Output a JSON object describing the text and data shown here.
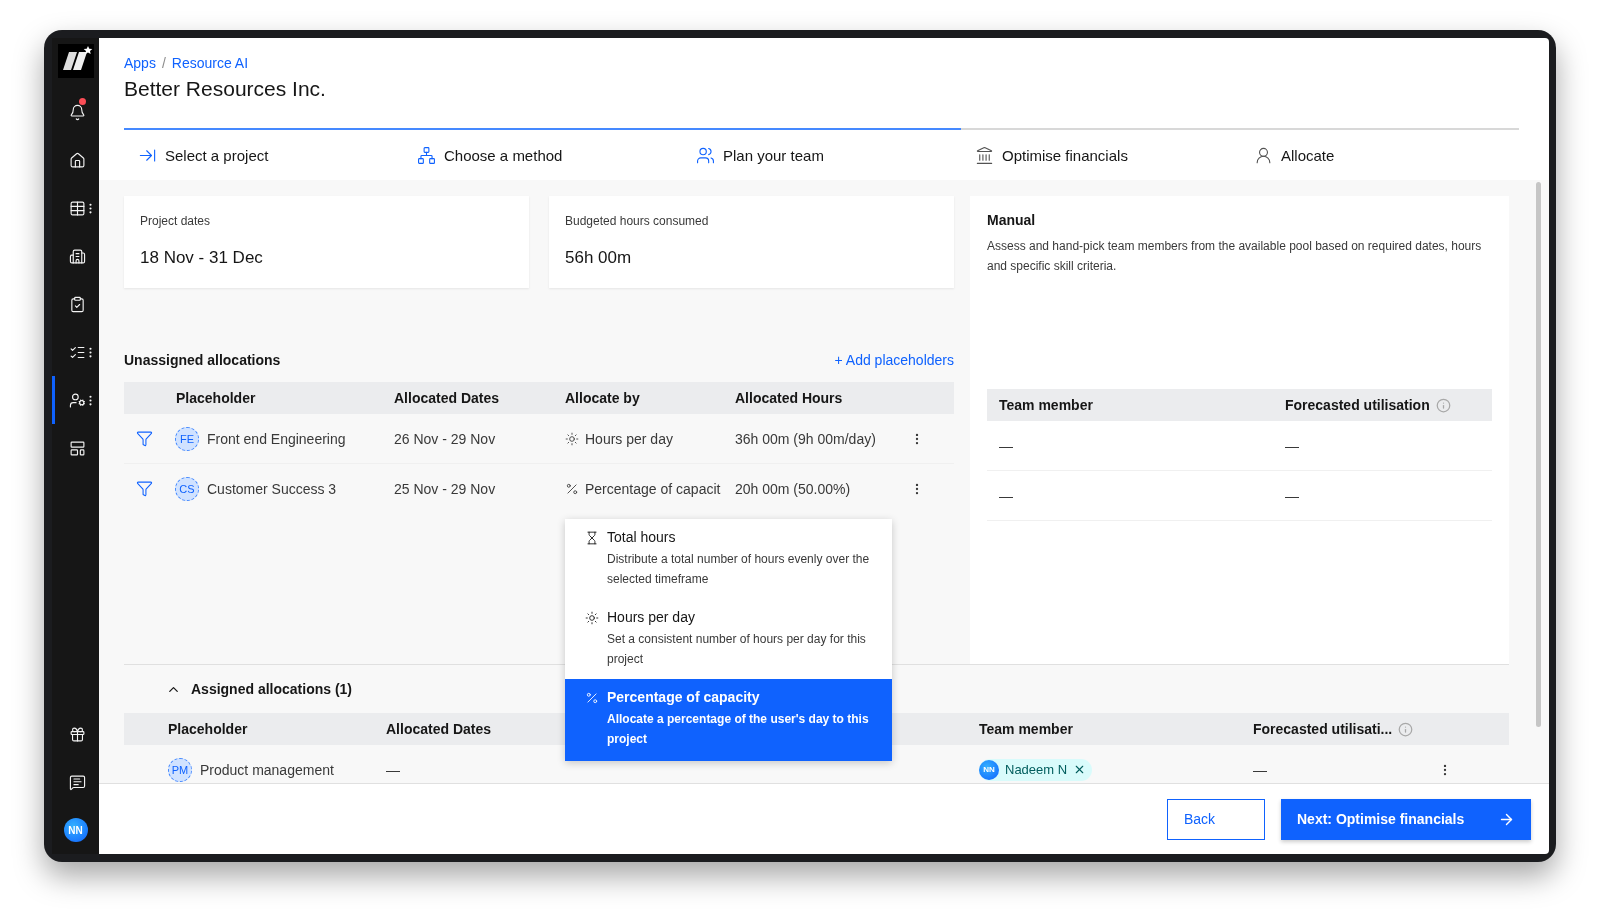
{
  "sidebar": {
    "top": [
      {
        "kind": "bell",
        "selected": false,
        "alert": true,
        "menu": false
      },
      {
        "kind": "home",
        "selected": false,
        "alert": false,
        "menu": false
      },
      {
        "kind": "table",
        "selected": false,
        "alert": false,
        "menu": true
      },
      {
        "kind": "building",
        "selected": false,
        "alert": false,
        "menu": false
      },
      {
        "kind": "clipboard",
        "selected": false,
        "alert": false,
        "menu": false
      },
      {
        "kind": "checklist",
        "selected": false,
        "alert": false,
        "menu": true
      },
      {
        "kind": "people",
        "selected": true,
        "alert": false,
        "menu": true
      },
      {
        "kind": "layout",
        "selected": false,
        "alert": false,
        "menu": false
      }
    ],
    "bottom": [
      {
        "kind": "gift"
      },
      {
        "kind": "chat"
      }
    ],
    "avatar": "NN"
  },
  "breadcrumb": {
    "items": [
      "Apps",
      "Resource AI"
    ],
    "separator": "/"
  },
  "title": "Better Resources Inc.",
  "steps": [
    {
      "kind": "project",
      "label": "Select a project",
      "reached": true
    },
    {
      "kind": "method",
      "label": "Choose a method",
      "reached": true
    },
    {
      "kind": "team",
      "label": "Plan your team",
      "reached": true
    },
    {
      "kind": "finance",
      "label": "Optimise financials",
      "reached": false
    },
    {
      "kind": "allocate",
      "label": "Allocate",
      "reached": false
    }
  ],
  "cards": [
    {
      "label": "Project dates",
      "value": "18 Nov - 31 Dec"
    },
    {
      "label": "Budgeted hours consumed",
      "value": "56h 00m"
    }
  ],
  "method": {
    "title": "Manual",
    "description": "Assess and hand-pick team members from the available pool based on required dates, hours and specific skill criteria."
  },
  "unassigned": {
    "title": "Unassigned allocations",
    "add_link": "+ Add placeholders",
    "columns": [
      "Placeholder",
      "Allocated Dates",
      "Allocate by",
      "Allocated Hours"
    ],
    "rows": [
      {
        "initials": "FE",
        "name": "Front end Engineering",
        "dates": "26 Nov - 29 Nov",
        "kind": "day",
        "allocate_by": "Hours per day",
        "hours": "36h 00m (9h 00m/day)"
      },
      {
        "initials": "CS",
        "name": "Customer Success 3",
        "dates": "25 Nov - 29 Nov",
        "kind": "percent",
        "allocate_by": "Percentage of capacit",
        "hours": "20h 00m (50.00%)"
      }
    ]
  },
  "team_table": {
    "columns": [
      "Team member",
      "Forecasted utilisation"
    ],
    "rows": [
      {
        "member": "—",
        "forecast": "—"
      },
      {
        "member": "—",
        "forecast": "—"
      }
    ]
  },
  "dropdown": {
    "options": [
      {
        "kind": "total",
        "title": "Total hours",
        "description": "Distribute a total number of hours evenly over the selected timeframe",
        "selected": false
      },
      {
        "kind": "day",
        "title": "Hours per day",
        "description": "Set a consistent number of hours per day for this project",
        "selected": false
      },
      {
        "kind": "percent",
        "title": "Percentage of capacity",
        "description": "Allocate a percentage of the user's day to this project",
        "selected": true
      }
    ]
  },
  "assigned": {
    "title": "Assigned allocations (1)",
    "expanded": true,
    "columns": [
      "Placeholder",
      "Allocated Dates",
      "Team member",
      "Forecasted utilisati..."
    ],
    "rows": [
      {
        "initials": "PM",
        "name": "Product management",
        "dates": "—",
        "member_initials": "NN",
        "member": "Nadeem N",
        "forecast": "—"
      }
    ]
  },
  "footer": {
    "back": "Back",
    "next": "Next: Optimise financials"
  }
}
